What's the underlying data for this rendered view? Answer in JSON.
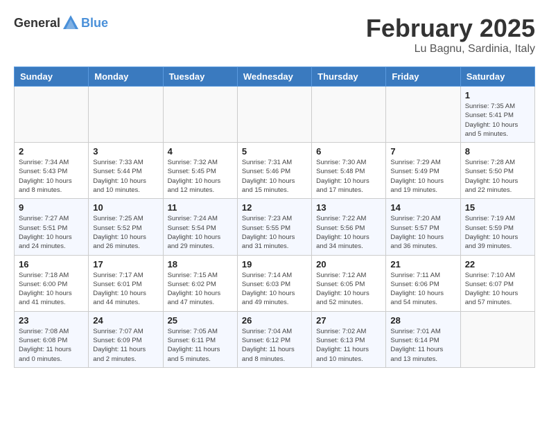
{
  "header": {
    "logo_general": "General",
    "logo_blue": "Blue",
    "month_title": "February 2025",
    "location": "Lu Bagnu, Sardinia, Italy"
  },
  "calendar": {
    "days_of_week": [
      "Sunday",
      "Monday",
      "Tuesday",
      "Wednesday",
      "Thursday",
      "Friday",
      "Saturday"
    ],
    "weeks": [
      [
        {
          "day": "",
          "info": ""
        },
        {
          "day": "",
          "info": ""
        },
        {
          "day": "",
          "info": ""
        },
        {
          "day": "",
          "info": ""
        },
        {
          "day": "",
          "info": ""
        },
        {
          "day": "",
          "info": ""
        },
        {
          "day": "1",
          "info": "Sunrise: 7:35 AM\nSunset: 5:41 PM\nDaylight: 10 hours\nand 5 minutes."
        }
      ],
      [
        {
          "day": "2",
          "info": "Sunrise: 7:34 AM\nSunset: 5:43 PM\nDaylight: 10 hours\nand 8 minutes."
        },
        {
          "day": "3",
          "info": "Sunrise: 7:33 AM\nSunset: 5:44 PM\nDaylight: 10 hours\nand 10 minutes."
        },
        {
          "day": "4",
          "info": "Sunrise: 7:32 AM\nSunset: 5:45 PM\nDaylight: 10 hours\nand 12 minutes."
        },
        {
          "day": "5",
          "info": "Sunrise: 7:31 AM\nSunset: 5:46 PM\nDaylight: 10 hours\nand 15 minutes."
        },
        {
          "day": "6",
          "info": "Sunrise: 7:30 AM\nSunset: 5:48 PM\nDaylight: 10 hours\nand 17 minutes."
        },
        {
          "day": "7",
          "info": "Sunrise: 7:29 AM\nSunset: 5:49 PM\nDaylight: 10 hours\nand 19 minutes."
        },
        {
          "day": "8",
          "info": "Sunrise: 7:28 AM\nSunset: 5:50 PM\nDaylight: 10 hours\nand 22 minutes."
        }
      ],
      [
        {
          "day": "9",
          "info": "Sunrise: 7:27 AM\nSunset: 5:51 PM\nDaylight: 10 hours\nand 24 minutes."
        },
        {
          "day": "10",
          "info": "Sunrise: 7:25 AM\nSunset: 5:52 PM\nDaylight: 10 hours\nand 26 minutes."
        },
        {
          "day": "11",
          "info": "Sunrise: 7:24 AM\nSunset: 5:54 PM\nDaylight: 10 hours\nand 29 minutes."
        },
        {
          "day": "12",
          "info": "Sunrise: 7:23 AM\nSunset: 5:55 PM\nDaylight: 10 hours\nand 31 minutes."
        },
        {
          "day": "13",
          "info": "Sunrise: 7:22 AM\nSunset: 5:56 PM\nDaylight: 10 hours\nand 34 minutes."
        },
        {
          "day": "14",
          "info": "Sunrise: 7:20 AM\nSunset: 5:57 PM\nDaylight: 10 hours\nand 36 minutes."
        },
        {
          "day": "15",
          "info": "Sunrise: 7:19 AM\nSunset: 5:59 PM\nDaylight: 10 hours\nand 39 minutes."
        }
      ],
      [
        {
          "day": "16",
          "info": "Sunrise: 7:18 AM\nSunset: 6:00 PM\nDaylight: 10 hours\nand 41 minutes."
        },
        {
          "day": "17",
          "info": "Sunrise: 7:17 AM\nSunset: 6:01 PM\nDaylight: 10 hours\nand 44 minutes."
        },
        {
          "day": "18",
          "info": "Sunrise: 7:15 AM\nSunset: 6:02 PM\nDaylight: 10 hours\nand 47 minutes."
        },
        {
          "day": "19",
          "info": "Sunrise: 7:14 AM\nSunset: 6:03 PM\nDaylight: 10 hours\nand 49 minutes."
        },
        {
          "day": "20",
          "info": "Sunrise: 7:12 AM\nSunset: 6:05 PM\nDaylight: 10 hours\nand 52 minutes."
        },
        {
          "day": "21",
          "info": "Sunrise: 7:11 AM\nSunset: 6:06 PM\nDaylight: 10 hours\nand 54 minutes."
        },
        {
          "day": "22",
          "info": "Sunrise: 7:10 AM\nSunset: 6:07 PM\nDaylight: 10 hours\nand 57 minutes."
        }
      ],
      [
        {
          "day": "23",
          "info": "Sunrise: 7:08 AM\nSunset: 6:08 PM\nDaylight: 11 hours\nand 0 minutes."
        },
        {
          "day": "24",
          "info": "Sunrise: 7:07 AM\nSunset: 6:09 PM\nDaylight: 11 hours\nand 2 minutes."
        },
        {
          "day": "25",
          "info": "Sunrise: 7:05 AM\nSunset: 6:11 PM\nDaylight: 11 hours\nand 5 minutes."
        },
        {
          "day": "26",
          "info": "Sunrise: 7:04 AM\nSunset: 6:12 PM\nDaylight: 11 hours\nand 8 minutes."
        },
        {
          "day": "27",
          "info": "Sunrise: 7:02 AM\nSunset: 6:13 PM\nDaylight: 11 hours\nand 10 minutes."
        },
        {
          "day": "28",
          "info": "Sunrise: 7:01 AM\nSunset: 6:14 PM\nDaylight: 11 hours\nand 13 minutes."
        },
        {
          "day": "",
          "info": ""
        }
      ]
    ]
  }
}
